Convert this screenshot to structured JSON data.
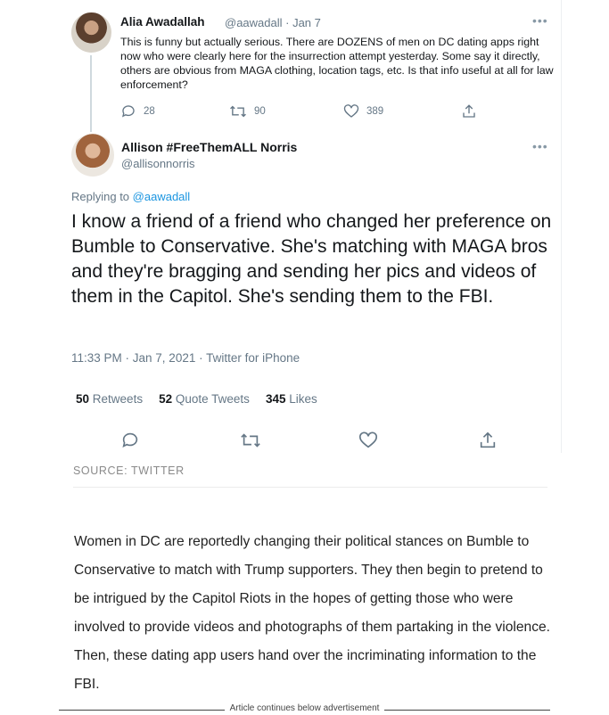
{
  "first_tweet": {
    "name": "Alia Awadallah",
    "handle_date": "@aawadall · Jan 7",
    "text": "This is funny but actually serious. There are DOZENS of men on DC dating apps right now who were clearly here for the insurrection attempt yesterday. Some say it directly, others are obvious from MAGA clothing, location tags, etc. Is that info useful at all for law enforcement?",
    "replies": "28",
    "retweets": "90",
    "likes": "389"
  },
  "main_tweet": {
    "name": "Allison #FreeThemALL Norris",
    "handle": "@allisonnorris",
    "replying_label": "Replying to",
    "replying_to": "@aawadall",
    "text": "I know a friend of a friend who changed her preference on Bumble to Conservative. She's matching with MAGA bros and they're bragging and sending her pics and videos of them in the Capitol. She's sending them to the FBI.",
    "timestamp": "11:33 PM · Jan 7, 2021 · Twitter for iPhone",
    "retweets_count": "50",
    "retweets_label": "Retweets",
    "quote_count": "52",
    "quote_label": "Quote Tweets",
    "likes_count": "345",
    "likes_label": "Likes"
  },
  "source": "SOURCE: TWITTER",
  "article_paragraph": "Women in DC are reportedly changing their political stances on Bumble to Conservative to match with Trump supporters. They then begin to pretend to be intrigued by the Capitol Riots in the hopes of getting those who were involved to provide videos and photographs of them partaking in the violence. Then, these dating app users hand over the incriminating information to the FBI.",
  "ad_label": "Article continues below advertisement",
  "icons": [
    "reply-icon",
    "retweet-icon",
    "like-icon",
    "share-icon",
    "more-icon"
  ],
  "colors": {
    "mention": "#1b95e0",
    "muted": "#657786",
    "text": "#14171a"
  }
}
